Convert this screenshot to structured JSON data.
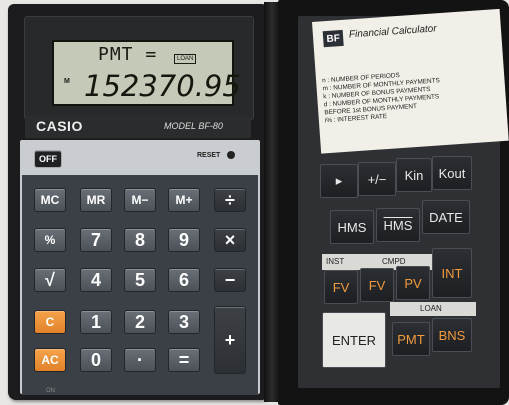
{
  "display": {
    "function": "PMT =",
    "annunciator": "LOAN",
    "memory_indicator": "M",
    "value": "152370.95"
  },
  "brand": "CASIO",
  "model": "MODEL BF-80",
  "reset_label": "RESET",
  "on_label": "ON",
  "keys": {
    "off": "OFF",
    "mc": "MC",
    "mr": "MR",
    "mminus": "M−",
    "mplus": "M+",
    "div": "÷",
    "pct": "%",
    "k7": "7",
    "k8": "8",
    "k9": "9",
    "mul": "×",
    "sqrt": "√",
    "k4": "4",
    "k5": "5",
    "k6": "6",
    "minus": "−",
    "c": "C",
    "k1": "1",
    "k2": "2",
    "k3": "3",
    "plus": "+",
    "ac": "AC",
    "k0": "0",
    "dot": "·",
    "eq": "="
  },
  "cover": {
    "logo": "BF",
    "title": "Financial Calculator",
    "legend": [
      "n  : NUMBER OF PERIODS",
      "m  : NUMBER OF MONTHLY PAYMENTS",
      "k  : NUMBER OF BONUS PAYMENTS",
      "d  : NUMBER OF MONTHLY PAYMENTS",
      "       BEFORE 1st BONUS PAYMENT",
      "i%  : INTEREST RATE"
    ],
    "keys": {
      "arrow": "▸",
      "plusminus": "+/−",
      "kin": "Kin",
      "kout": "Kout",
      "hms": "HMS",
      "hms_bar": "HMS",
      "date": "DATE",
      "inst": "INST",
      "cmpd": "CMPD",
      "int": "INT",
      "fv1": "FV",
      "fv2": "FV",
      "pv": "PV",
      "loan": "LOAN",
      "enter": "ENTER",
      "pmt": "PMT",
      "bns": "BNS"
    }
  }
}
